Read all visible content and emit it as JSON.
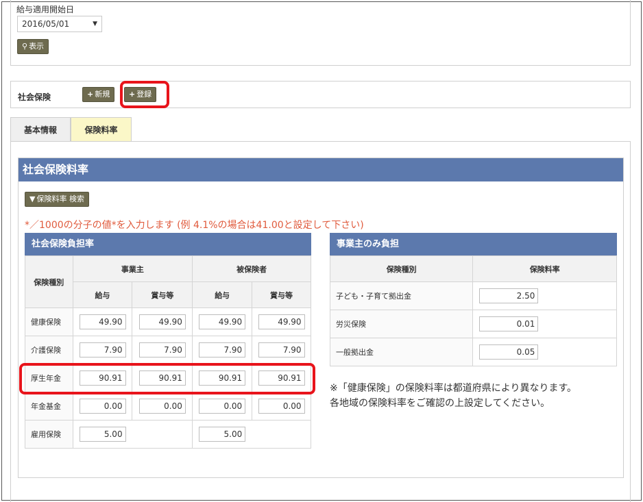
{
  "top": {
    "field_label": "給与適用開始日",
    "date_value": "2016/05/01",
    "show_button": "表示",
    "show_icon": "search-icon"
  },
  "insurance": {
    "label": "社会保険",
    "new_button": "新規",
    "register_button": "登録"
  },
  "tabs": [
    "基本情報",
    "保険料率"
  ],
  "section": {
    "title": "社会保険料率",
    "search_button": "保険料率 検索",
    "note": "*／1000の分子の値*を入力します (例 4.1%の場合は41.00と設定して下さい)"
  },
  "left_table": {
    "title": "社会保険負担率",
    "col_type": "保険種別",
    "group_employer": "事業主",
    "group_insured": "被保険者",
    "sub_salary": "給与",
    "sub_bonus": "賞与等",
    "rows": [
      {
        "label": "健康保険",
        "values": [
          "49.90",
          "49.90",
          "49.90",
          "49.90"
        ]
      },
      {
        "label": "介護保険",
        "values": [
          "7.90",
          "7.90",
          "7.90",
          "7.90"
        ]
      },
      {
        "label": "厚生年金",
        "values": [
          "90.91",
          "90.91",
          "90.91",
          "90.91"
        ]
      },
      {
        "label": "年金基金",
        "values": [
          "0.00",
          "0.00",
          "0.00",
          "0.00"
        ]
      },
      {
        "label": "雇用保険",
        "values": [
          "5.00",
          "",
          "5.00",
          ""
        ]
      }
    ]
  },
  "right_table": {
    "title": "事業主のみ負担",
    "col_type": "保険種別",
    "col_rate": "保険料率",
    "rows": [
      {
        "label": "子ども・子育て拠出金",
        "value": "2.50"
      },
      {
        "label": "労災保険",
        "value": "0.01"
      },
      {
        "label": "一般拠出金",
        "value": "0.05"
      }
    ]
  },
  "right_note": {
    "line1": "※「健康保険」の保険料率は都道府県により異なります。",
    "line2": "各地域の保険料率をご確認の上設定してください。"
  },
  "colors": {
    "header_blue": "#5c79ad",
    "button_olive": "#6e6b4f",
    "highlight_red": "#e8141b",
    "note_red": "#e05a3c",
    "active_tab": "#fbf7c8"
  }
}
